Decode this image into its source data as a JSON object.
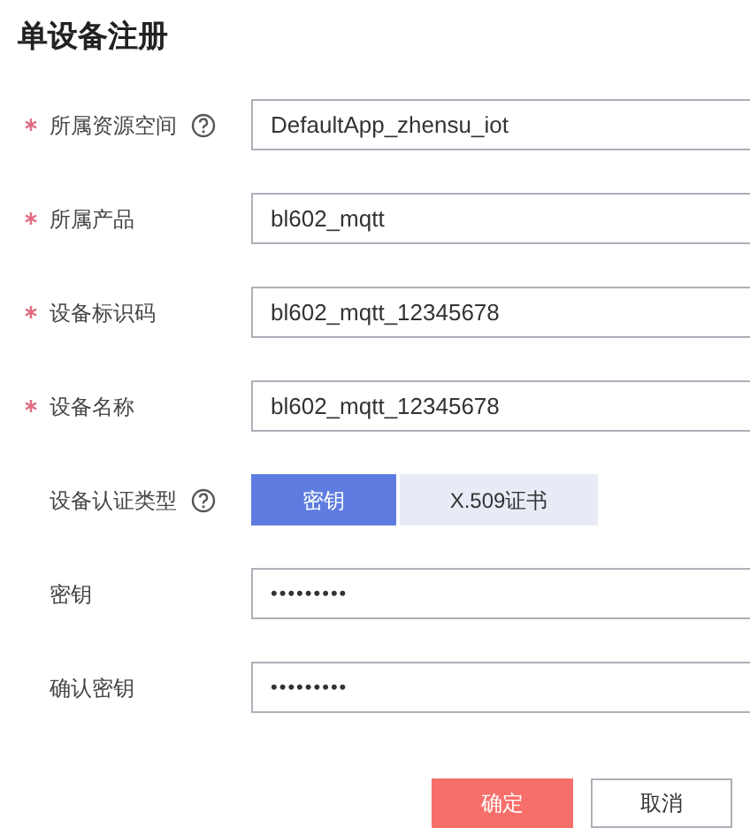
{
  "title": "单设备注册",
  "fields": [
    {
      "kind": "text",
      "label": "所属资源空间",
      "required": true,
      "help": true,
      "value": "DefaultApp_zhensu_iot"
    },
    {
      "kind": "text",
      "label": "所属产品",
      "required": true,
      "help": false,
      "value": "bl602_mqtt"
    },
    {
      "kind": "text",
      "label": "设备标识码",
      "required": true,
      "help": false,
      "value": "bl602_mqtt_12345678"
    },
    {
      "kind": "text",
      "label": "设备名称",
      "required": true,
      "help": false,
      "value": "bl602_mqtt_12345678"
    },
    {
      "kind": "segmented",
      "label": "设备认证类型",
      "required": false,
      "help": true,
      "options": [
        {
          "label": "密钥",
          "selected": true
        },
        {
          "label": "X.509证书",
          "selected": false
        }
      ]
    },
    {
      "kind": "password",
      "label": "密钥",
      "required": false,
      "help": false,
      "value": "•••••••••"
    },
    {
      "kind": "password",
      "label": "确认密钥",
      "required": false,
      "help": false,
      "value": "•••••••••"
    }
  ],
  "buttons": [
    {
      "kind": "primary",
      "label": "确定"
    },
    {
      "kind": "secondary",
      "label": "取消"
    }
  ]
}
